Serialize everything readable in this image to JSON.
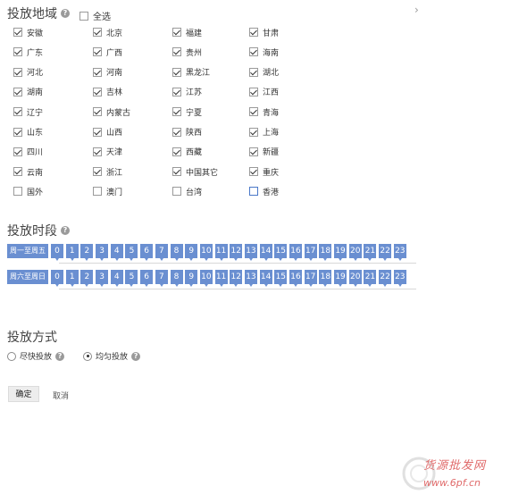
{
  "region_section": {
    "title": "投放地域",
    "select_all_label": "全选"
  },
  "regions": [
    {
      "label": "安徽",
      "checked": true
    },
    {
      "label": "北京",
      "checked": true
    },
    {
      "label": "福建",
      "checked": true
    },
    {
      "label": "甘肃",
      "checked": true
    },
    {
      "label": "广东",
      "checked": true
    },
    {
      "label": "广西",
      "checked": true
    },
    {
      "label": "贵州",
      "checked": true
    },
    {
      "label": "海南",
      "checked": true
    },
    {
      "label": "河北",
      "checked": true
    },
    {
      "label": "河南",
      "checked": true
    },
    {
      "label": "黑龙江",
      "checked": true
    },
    {
      "label": "湖北",
      "checked": true
    },
    {
      "label": "湖南",
      "checked": true
    },
    {
      "label": "吉林",
      "checked": true
    },
    {
      "label": "江苏",
      "checked": true
    },
    {
      "label": "江西",
      "checked": true
    },
    {
      "label": "辽宁",
      "checked": true
    },
    {
      "label": "内蒙古",
      "checked": true
    },
    {
      "label": "宁夏",
      "checked": true
    },
    {
      "label": "青海",
      "checked": true
    },
    {
      "label": "山东",
      "checked": true
    },
    {
      "label": "山西",
      "checked": true
    },
    {
      "label": "陕西",
      "checked": true
    },
    {
      "label": "上海",
      "checked": true
    },
    {
      "label": "四川",
      "checked": true
    },
    {
      "label": "天津",
      "checked": true
    },
    {
      "label": "西藏",
      "checked": true
    },
    {
      "label": "新疆",
      "checked": true
    },
    {
      "label": "云南",
      "checked": true
    },
    {
      "label": "浙江",
      "checked": true
    },
    {
      "label": "中国其它",
      "checked": true
    },
    {
      "label": "重庆",
      "checked": true
    },
    {
      "label": "国外",
      "checked": false
    },
    {
      "label": "澳门",
      "checked": false
    },
    {
      "label": "台湾",
      "checked": false
    },
    {
      "label": "香港",
      "checked": false
    }
  ],
  "time_section": {
    "title": "投放时段",
    "rows": [
      {
        "label": "周一至周五",
        "hours": [
          "0",
          "1",
          "2",
          "3",
          "4",
          "5",
          "6",
          "7",
          "8",
          "9",
          "10",
          "11",
          "12",
          "13",
          "14",
          "15",
          "16",
          "17",
          "18",
          "19",
          "20",
          "21",
          "22",
          "23"
        ]
      },
      {
        "label": "周六至周日",
        "hours": [
          "0",
          "1",
          "2",
          "3",
          "4",
          "5",
          "6",
          "7",
          "8",
          "9",
          "10",
          "11",
          "12",
          "13",
          "14",
          "15",
          "16",
          "17",
          "18",
          "19",
          "20",
          "21",
          "22",
          "23"
        ]
      }
    ]
  },
  "method_section": {
    "title": "投放方式",
    "options": [
      {
        "label": "尽快投放",
        "checked": false
      },
      {
        "label": "均匀投放",
        "checked": true
      }
    ]
  },
  "actions": {
    "confirm": "确定",
    "cancel": "取消"
  },
  "watermark": {
    "line1": "货源批发网",
    "line2": "www.6pf.cn"
  },
  "colors": {
    "slot_blue": "#6a8fd1",
    "watermark_red": "#e06a6a"
  }
}
